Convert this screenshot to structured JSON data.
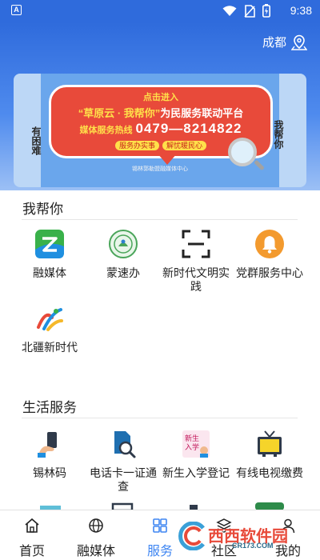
{
  "status_bar": {
    "time": "9:38",
    "icons": [
      "wifi-icon",
      "no-sim-icon",
      "battery-icon"
    ]
  },
  "header": {
    "location": "成都",
    "location_icon": "map-pin-icon"
  },
  "banner": {
    "tag": "点击进入",
    "title_quote": "“草原云 · 我帮你”",
    "title_rest": "为民服务联动平台",
    "hotline_label": "媒体服务热线",
    "hotline_number": "0479—8214822",
    "sub_tags": [
      "服务办实事",
      "解忧暖民心"
    ],
    "org_text": "锡林郭勒盟融媒体中心",
    "side_left": "有困难",
    "side_right": "我帮你"
  },
  "section_help": {
    "title": "我帮你",
    "items": [
      {
        "label": "融媒体",
        "icon": "media-app-icon"
      },
      {
        "label": "蒙速办",
        "icon": "emblem-icon"
      },
      {
        "label": "新时代文明实践",
        "icon": "scan-frame-icon"
      },
      {
        "label": "党群服务中心",
        "icon": "bell-icon"
      },
      {
        "label": "北疆新时代",
        "icon": "northland-logo-icon"
      }
    ]
  },
  "section_life": {
    "title": "生活服务",
    "items": [
      {
        "label": "锡林码",
        "icon": "hand-phone-icon"
      },
      {
        "label": "电话卡一证通查",
        "icon": "sim-search-icon"
      },
      {
        "label": "新生入学登记",
        "icon": "enrollment-icon"
      },
      {
        "label": "有线电视缴费",
        "icon": "tv-icon"
      }
    ]
  },
  "tab_bar": {
    "tabs": [
      {
        "label": "首页",
        "icon": "home-icon"
      },
      {
        "label": "融媒体",
        "icon": "globe-icon"
      },
      {
        "label": "服务",
        "icon": "grid-icon"
      },
      {
        "label": "社区",
        "icon": "layers-icon"
      },
      {
        "label": "我的",
        "icon": "user-icon"
      }
    ],
    "active_index": 2
  },
  "watermark": {
    "text": "西西软件园",
    "sub": "CR173.COM"
  },
  "colors": {
    "primary": "#2f6bdc",
    "accent": "#3f86f2",
    "banner_red": "#e84a3a"
  }
}
